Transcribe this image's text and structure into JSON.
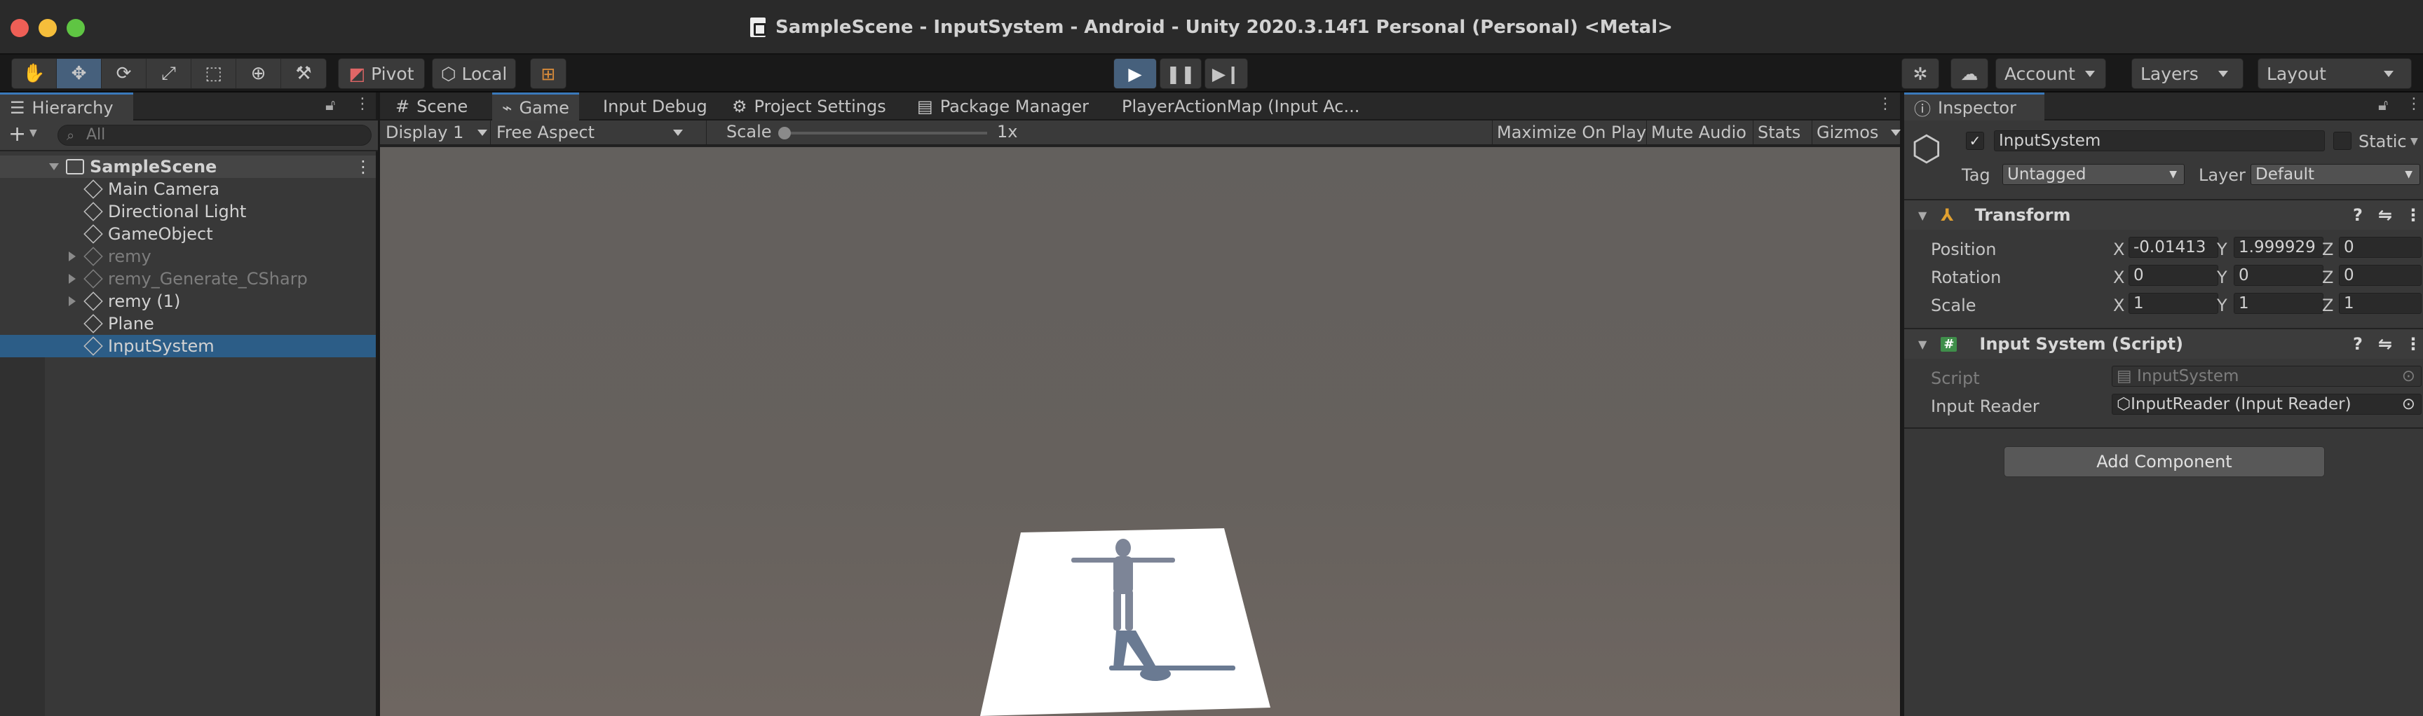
{
  "window": {
    "title": "SampleScene - InputSystem - Android - Unity 2020.3.14f1 Personal (Personal) <Metal>"
  },
  "toolbar": {
    "pivot": "Pivot",
    "local": "Local",
    "account": "Account",
    "layers": "Layers",
    "layout": "Layout"
  },
  "hierarchy": {
    "tab": "Hierarchy",
    "search_placeholder": "All",
    "scene": "SampleScene",
    "items": [
      "Main Camera",
      "Directional Light",
      "GameObject",
      "remy",
      "remy_Generate_CSharp",
      "remy (1)",
      "Plane",
      "InputSystem"
    ]
  },
  "center_tabs": {
    "scene": "Scene",
    "game": "Game",
    "input_debug": "Input Debug",
    "project_settings": "Project Settings",
    "package_manager": "Package Manager",
    "action_map": "PlayerActionMap (Input Ac..."
  },
  "game_bar": {
    "display": "Display 1",
    "aspect": "Free Aspect",
    "scale_label": "Scale",
    "scale_value": "1x",
    "maximize": "Maximize On Play",
    "mute": "Mute Audio",
    "stats": "Stats",
    "gizmos": "Gizmos"
  },
  "inspector": {
    "tab": "Inspector",
    "object_name": "InputSystem",
    "static": "Static",
    "tag_label": "Tag",
    "tag_value": "Untagged",
    "layer_label": "Layer",
    "layer_value": "Default",
    "transform": {
      "title": "Transform",
      "position_label": "Position",
      "rotation_label": "Rotation",
      "scale_label": "Scale",
      "x": "X",
      "y": "Y",
      "z": "Z",
      "position": [
        "-0.01413",
        "1.999929",
        "0"
      ],
      "rotation": [
        "0",
        "0",
        "0"
      ],
      "scale": [
        "1",
        "1",
        "1"
      ]
    },
    "script_comp": {
      "title": "Input System (Script)",
      "script_label": "Script",
      "script_value": "InputSystem",
      "reader_label": "Input Reader",
      "reader_value": "InputReader (Input Reader)"
    },
    "add_component": "Add Component"
  },
  "colors": {
    "selection": "#2c5d87",
    "accent_tab": "#3a79bb",
    "play_active": "#46607c"
  }
}
